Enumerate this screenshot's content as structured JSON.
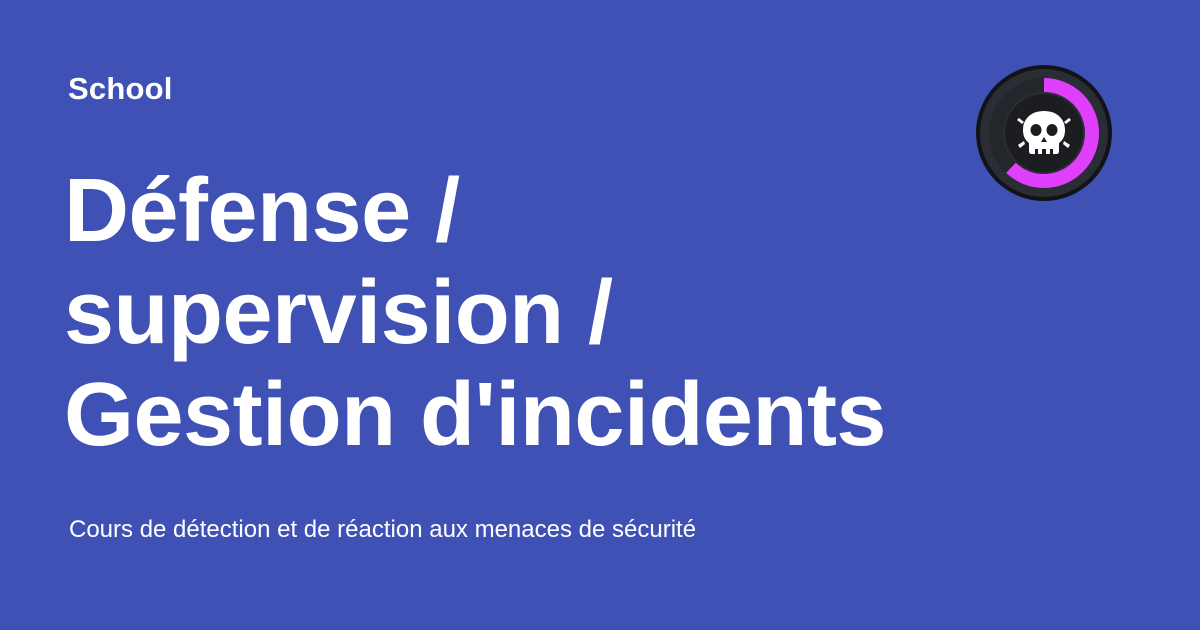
{
  "brand": {
    "label": "School"
  },
  "headline": {
    "lines": [
      "Défense /",
      "supervision /",
      "Gestion d'incidents"
    ]
  },
  "subtitle": "Cours de détection et de réaction aux menaces de sécurité",
  "badge": {
    "icon": "skull-icon",
    "progress": 0.62,
    "progress_color": "#e040fb",
    "ring_track_color": "#23262b",
    "outer_color": "#2a2d33"
  },
  "colors": {
    "background": "#3f51b5",
    "text": "#ffffff"
  }
}
